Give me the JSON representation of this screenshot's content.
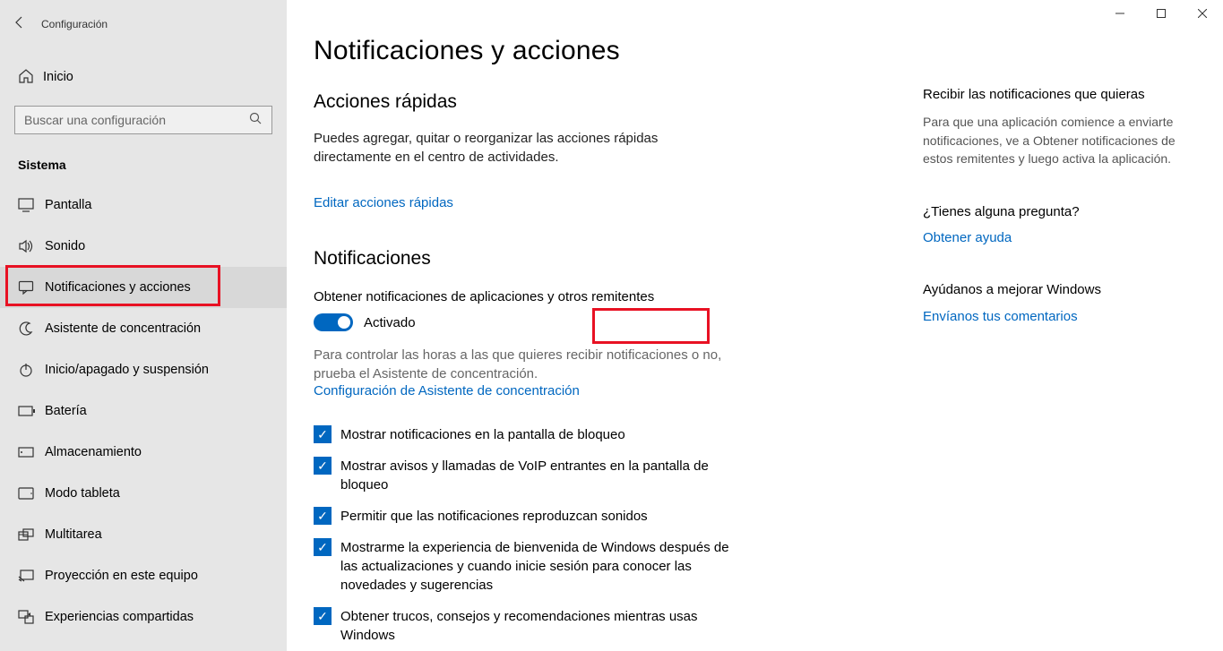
{
  "window": {
    "app_title": "Configuración",
    "minimize": "—",
    "maximize": "☐",
    "close": "✕"
  },
  "sidebar": {
    "home_label": "Inicio",
    "search_placeholder": "Buscar una configuración",
    "section_label": "Sistema",
    "items": [
      {
        "label": "Pantalla",
        "icon": "monitor"
      },
      {
        "label": "Sonido",
        "icon": "sound"
      },
      {
        "label": "Notificaciones y acciones",
        "icon": "chat",
        "selected": true,
        "highlighted": true
      },
      {
        "label": "Asistente de concentración",
        "icon": "moon"
      },
      {
        "label": "Inicio/apagado y suspensión",
        "icon": "power"
      },
      {
        "label": "Batería",
        "icon": "battery"
      },
      {
        "label": "Almacenamiento",
        "icon": "storage"
      },
      {
        "label": "Modo tableta",
        "icon": "tablet"
      },
      {
        "label": "Multitarea",
        "icon": "multitask"
      },
      {
        "label": "Proyección en este equipo",
        "icon": "project"
      },
      {
        "label": "Experiencias compartidas",
        "icon": "shared"
      }
    ]
  },
  "main": {
    "title": "Notificaciones y acciones",
    "quick_actions": {
      "heading": "Acciones rápidas",
      "body": "Puedes agregar, quitar o reorganizar las acciones rápidas directamente en el centro de actividades.",
      "link": "Editar acciones rápidas"
    },
    "notifications": {
      "heading": "Notificaciones",
      "toggle_label": "Obtener notificaciones de aplicaciones y otros remitentes",
      "toggle_state_label": "Activado",
      "toggle_on": true,
      "muted": "Para controlar las horas a las que quieres recibir notificaciones o no, prueba el Asistente de concentración.",
      "muted_link": "Configuración de Asistente de concentración",
      "checkboxes": [
        {
          "label": "Mostrar notificaciones en la pantalla de bloqueo",
          "checked": true
        },
        {
          "label": "Mostrar avisos y llamadas de VoIP entrantes en la pantalla de bloqueo",
          "checked": true
        },
        {
          "label": "Permitir que las notificaciones reproduzcan sonidos",
          "checked": true
        },
        {
          "label": "Mostrarme la experiencia de bienvenida de Windows después de las actualizaciones y cuando inicie sesión para conocer las novedades y sugerencias",
          "checked": true
        },
        {
          "label": "Obtener trucos, consejos y recomendaciones mientras usas Windows",
          "checked": true
        }
      ]
    }
  },
  "rightPanel": {
    "block1": {
      "heading": "Recibir las notificaciones que quieras",
      "body": "Para que una aplicación comience a enviarte notificaciones, ve a Obtener notificaciones de estos remitentes y luego activa la aplicación."
    },
    "block2": {
      "heading": "¿Tienes alguna pregunta?",
      "link": "Obtener ayuda"
    },
    "block3": {
      "heading": "Ayúdanos a mejorar Windows",
      "link": "Envíanos tus comentarios"
    }
  }
}
